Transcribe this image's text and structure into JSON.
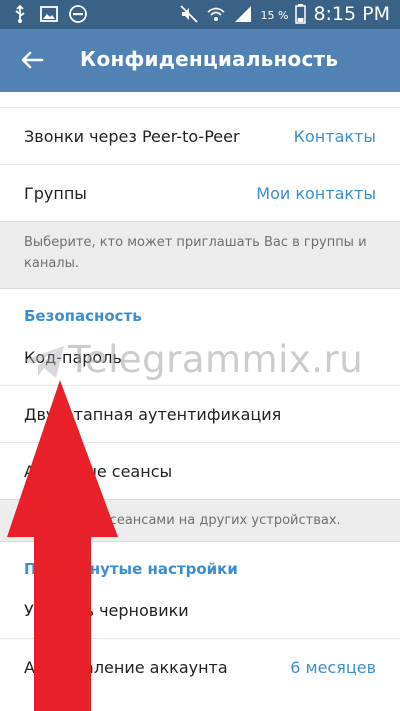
{
  "status_bar": {
    "battery_percent": "15 %",
    "time": "8:15 PM",
    "icons": [
      "usb-icon",
      "image-icon",
      "dnd-icon",
      "mute-icon",
      "wifi-icon",
      "signal-icon",
      "battery-icon"
    ]
  },
  "header": {
    "title": "Конфиденциальность",
    "back_icon": "back-arrow-icon"
  },
  "rows": [
    {
      "label": "Звонки через Peer-to-Peer",
      "value": "Контакты"
    },
    {
      "label": "Группы",
      "value": "Мои контакты"
    }
  ],
  "groups_hint": "Выберите, кто может приглашать Вас в группы и каналы.",
  "security": {
    "title": "Безопасность",
    "items": [
      {
        "label": "Код-пароль"
      },
      {
        "label": "Двухэтапная аутентификация"
      },
      {
        "label": "Активные сеансы"
      }
    ],
    "hint": "Управление сеансами на других устройствах."
  },
  "advanced": {
    "title": "Продвинутые настройки",
    "items": [
      {
        "label": "Удалить черновики",
        "value": ""
      },
      {
        "label": "Автоудаление аккаунта",
        "value": "6 месяцев"
      }
    ]
  },
  "watermark": "Telegrammix.ru",
  "colors": {
    "status_bar": "#3a6287",
    "action_bar": "#5182b3",
    "accent": "#3c8fcf",
    "arrow": "#e8202a"
  }
}
